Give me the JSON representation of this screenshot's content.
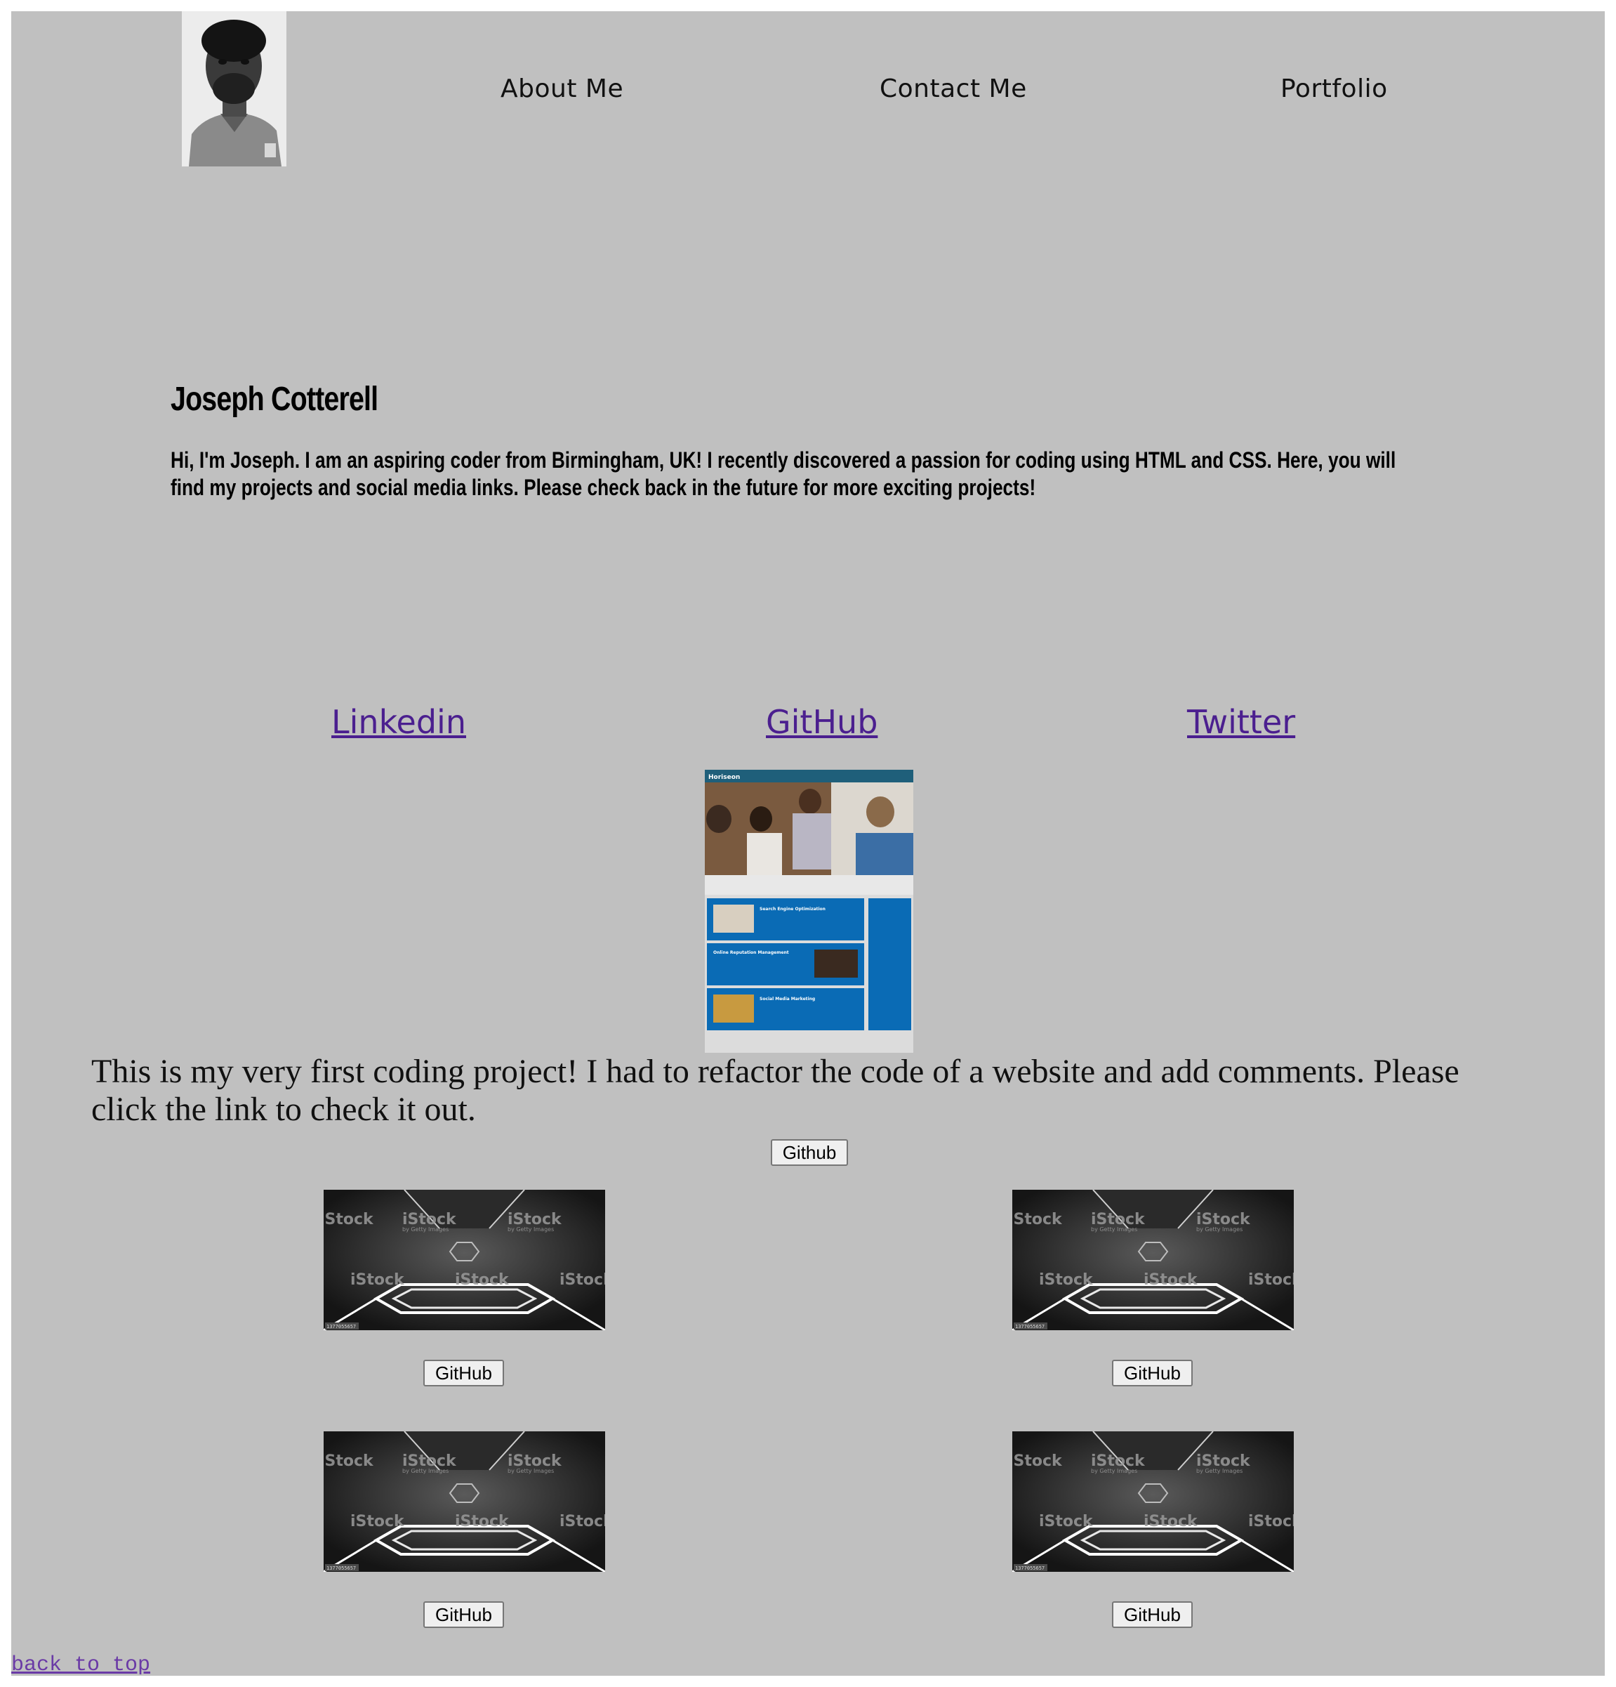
{
  "nav": {
    "about": "About Me",
    "contact": "Contact Me",
    "portfolio": "Portfolio"
  },
  "hero": {
    "name": "Joseph Cotterell",
    "text": "Hi, I'm Joseph. I am an aspiring coder from Birmingham, UK! I recently discovered a passion for coding using HTML and CSS. Here, you will find my projects and social media links. Please check back in the future for more exciting projects!"
  },
  "social": {
    "linkedin": "Linkedin",
    "github": "GitHub",
    "twitter": "Twitter"
  },
  "project": {
    "screenshot_brand": "Horiseon",
    "screenshot_sections": [
      "Search Engine Optimization",
      "Online Reputation Management",
      "Social Media Marketing"
    ],
    "description": "This is my very first coding project! I had to refactor the code of a website and add comments. Please click the link to check it out.",
    "button": "Github"
  },
  "gallery": {
    "watermark": "iStock",
    "watermark_sub": "by Getty Images",
    "stock_id": "1377055657",
    "button": "GitHub"
  },
  "footer": {
    "back_to_top": "back to top"
  },
  "colors": {
    "page_bg": "#c0c0c0",
    "link_visited": "#4b1f8f",
    "project_blue": "#0a6bb5",
    "project_header": "#1f5f7a"
  }
}
